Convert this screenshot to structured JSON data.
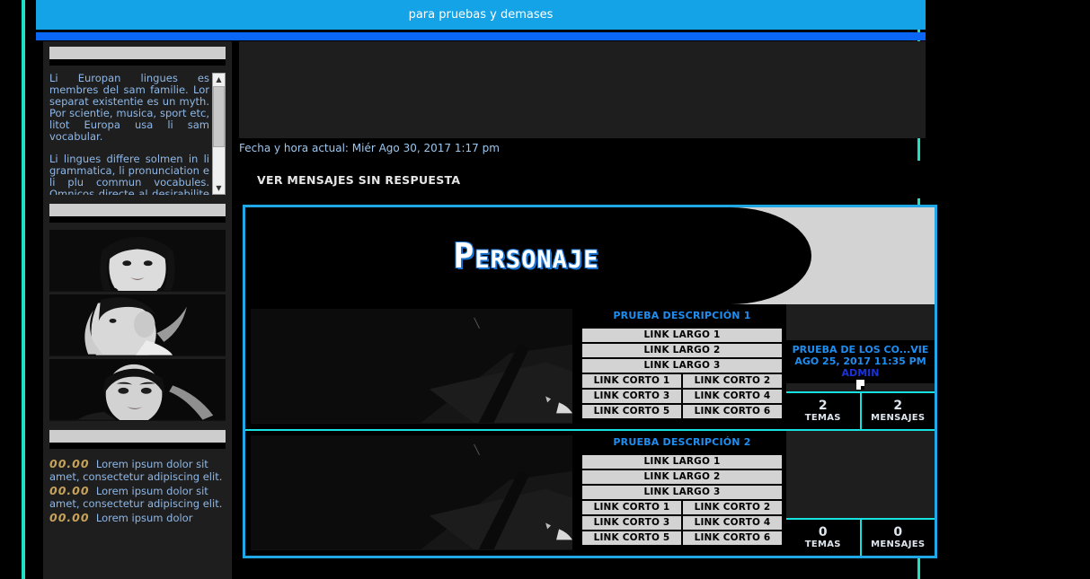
{
  "header": {
    "banner_text": "para pruebas y demases",
    "banner_color": "#14a3e6",
    "navbar_color": "#0a66f5"
  },
  "sidebar": {
    "widget1": {
      "title": "",
      "paragraphs": [
        "Li Europan lingues es membres del sam familie. Lor separat existentie es un myth. Por scientie, musica, sport etc, litot Europa usa li sam vocabular.",
        "Li lingues differe solmen in li grammatica, li pronunciation e li plu commun vocabules. Omnicos directe al desirabilite de un nov lingua"
      ],
      "scrollbar": {
        "up": "▲",
        "down": "▼"
      }
    },
    "widget2": {
      "title": "",
      "images": [
        "portrait-female",
        "portrait-male-profile",
        "portrait-male-front"
      ]
    },
    "widget3": {
      "title": "",
      "news": [
        {
          "date": "00.00",
          "text": "Lorem ipsum dolor sit amet, consectetur adipiscing elit."
        },
        {
          "date": "00.00",
          "text": "Lorem ipsum dolor sit amet, consectetur adipiscing elit."
        },
        {
          "date": "00.00",
          "text": "Lorem ipsum dolor"
        }
      ]
    }
  },
  "main": {
    "date_line": "Fecha y hora actual: Miér Ago 30, 2017 1:17 pm",
    "unanswered_label": "VER MENSAJES SIN RESPUESTA",
    "category": {
      "title": "Personaje",
      "border_color": "#1fa7e6",
      "forums": [
        {
          "description": "PRUEBA DESCRIPCIÓN 1",
          "long_links": [
            "LINK LARGO 1",
            "LINK LARGO 2",
            "LINK LARGO 3"
          ],
          "short_links": [
            [
              "LINK CORTO 1",
              "LINK CORTO 2"
            ],
            [
              "LINK CORTO 3",
              "LINK CORTO 4"
            ],
            [
              "LINK CORTO 5",
              "LINK CORTO 6"
            ]
          ],
          "last_post": {
            "title": "PRUEBA DE LOS CO...VIE AGO 25, 2017 11:35 PM",
            "user": "ADMIN",
            "icon": "broken-image-icon"
          },
          "stats": [
            {
              "value": "2",
              "label": "TEMAS"
            },
            {
              "value": "2",
              "label": "MENSAJES"
            }
          ]
        },
        {
          "description": "PRUEBA DESCRIPCIÓN 2",
          "long_links": [
            "LINK LARGO 1",
            "LINK LARGO 2",
            "LINK LARGO 3"
          ],
          "short_links": [
            [
              "LINK CORTO 1",
              "LINK CORTO 2"
            ],
            [
              "LINK CORTO 3",
              "LINK CORTO 4"
            ],
            [
              "LINK CORTO 5",
              "LINK CORTO 6"
            ]
          ],
          "last_post": {
            "title": "",
            "user": "",
            "icon": ""
          },
          "stats": [
            {
              "value": "0",
              "label": "TEMAS"
            },
            {
              "value": "0",
              "label": "MENSAJES"
            }
          ]
        }
      ]
    }
  }
}
